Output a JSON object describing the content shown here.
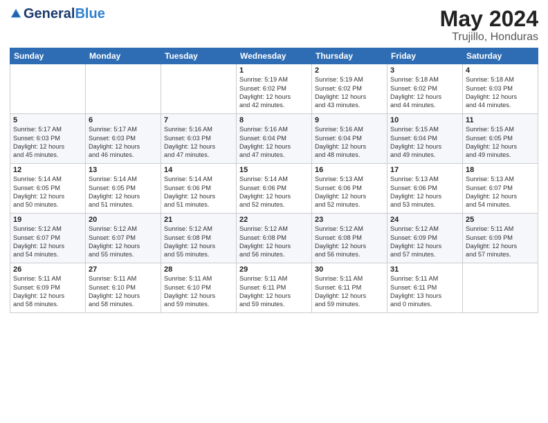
{
  "logo": {
    "general": "General",
    "blue": "Blue"
  },
  "title": {
    "month": "May 2024",
    "location": "Trujillo, Honduras"
  },
  "weekdays": [
    "Sunday",
    "Monday",
    "Tuesday",
    "Wednesday",
    "Thursday",
    "Friday",
    "Saturday"
  ],
  "weeks": [
    [
      {
        "day": null,
        "info": null
      },
      {
        "day": null,
        "info": null
      },
      {
        "day": null,
        "info": null
      },
      {
        "day": "1",
        "info": "Sunrise: 5:19 AM\nSunset: 6:02 PM\nDaylight: 12 hours\nand 42 minutes."
      },
      {
        "day": "2",
        "info": "Sunrise: 5:19 AM\nSunset: 6:02 PM\nDaylight: 12 hours\nand 43 minutes."
      },
      {
        "day": "3",
        "info": "Sunrise: 5:18 AM\nSunset: 6:02 PM\nDaylight: 12 hours\nand 44 minutes."
      },
      {
        "day": "4",
        "info": "Sunrise: 5:18 AM\nSunset: 6:03 PM\nDaylight: 12 hours\nand 44 minutes."
      }
    ],
    [
      {
        "day": "5",
        "info": "Sunrise: 5:17 AM\nSunset: 6:03 PM\nDaylight: 12 hours\nand 45 minutes."
      },
      {
        "day": "6",
        "info": "Sunrise: 5:17 AM\nSunset: 6:03 PM\nDaylight: 12 hours\nand 46 minutes."
      },
      {
        "day": "7",
        "info": "Sunrise: 5:16 AM\nSunset: 6:03 PM\nDaylight: 12 hours\nand 47 minutes."
      },
      {
        "day": "8",
        "info": "Sunrise: 5:16 AM\nSunset: 6:04 PM\nDaylight: 12 hours\nand 47 minutes."
      },
      {
        "day": "9",
        "info": "Sunrise: 5:16 AM\nSunset: 6:04 PM\nDaylight: 12 hours\nand 48 minutes."
      },
      {
        "day": "10",
        "info": "Sunrise: 5:15 AM\nSunset: 6:04 PM\nDaylight: 12 hours\nand 49 minutes."
      },
      {
        "day": "11",
        "info": "Sunrise: 5:15 AM\nSunset: 6:05 PM\nDaylight: 12 hours\nand 49 minutes."
      }
    ],
    [
      {
        "day": "12",
        "info": "Sunrise: 5:14 AM\nSunset: 6:05 PM\nDaylight: 12 hours\nand 50 minutes."
      },
      {
        "day": "13",
        "info": "Sunrise: 5:14 AM\nSunset: 6:05 PM\nDaylight: 12 hours\nand 51 minutes."
      },
      {
        "day": "14",
        "info": "Sunrise: 5:14 AM\nSunset: 6:06 PM\nDaylight: 12 hours\nand 51 minutes."
      },
      {
        "day": "15",
        "info": "Sunrise: 5:14 AM\nSunset: 6:06 PM\nDaylight: 12 hours\nand 52 minutes."
      },
      {
        "day": "16",
        "info": "Sunrise: 5:13 AM\nSunset: 6:06 PM\nDaylight: 12 hours\nand 52 minutes."
      },
      {
        "day": "17",
        "info": "Sunrise: 5:13 AM\nSunset: 6:06 PM\nDaylight: 12 hours\nand 53 minutes."
      },
      {
        "day": "18",
        "info": "Sunrise: 5:13 AM\nSunset: 6:07 PM\nDaylight: 12 hours\nand 54 minutes."
      }
    ],
    [
      {
        "day": "19",
        "info": "Sunrise: 5:12 AM\nSunset: 6:07 PM\nDaylight: 12 hours\nand 54 minutes."
      },
      {
        "day": "20",
        "info": "Sunrise: 5:12 AM\nSunset: 6:07 PM\nDaylight: 12 hours\nand 55 minutes."
      },
      {
        "day": "21",
        "info": "Sunrise: 5:12 AM\nSunset: 6:08 PM\nDaylight: 12 hours\nand 55 minutes."
      },
      {
        "day": "22",
        "info": "Sunrise: 5:12 AM\nSunset: 6:08 PM\nDaylight: 12 hours\nand 56 minutes."
      },
      {
        "day": "23",
        "info": "Sunrise: 5:12 AM\nSunset: 6:08 PM\nDaylight: 12 hours\nand 56 minutes."
      },
      {
        "day": "24",
        "info": "Sunrise: 5:12 AM\nSunset: 6:09 PM\nDaylight: 12 hours\nand 57 minutes."
      },
      {
        "day": "25",
        "info": "Sunrise: 5:11 AM\nSunset: 6:09 PM\nDaylight: 12 hours\nand 57 minutes."
      }
    ],
    [
      {
        "day": "26",
        "info": "Sunrise: 5:11 AM\nSunset: 6:09 PM\nDaylight: 12 hours\nand 58 minutes."
      },
      {
        "day": "27",
        "info": "Sunrise: 5:11 AM\nSunset: 6:10 PM\nDaylight: 12 hours\nand 58 minutes."
      },
      {
        "day": "28",
        "info": "Sunrise: 5:11 AM\nSunset: 6:10 PM\nDaylight: 12 hours\nand 59 minutes."
      },
      {
        "day": "29",
        "info": "Sunrise: 5:11 AM\nSunset: 6:11 PM\nDaylight: 12 hours\nand 59 minutes."
      },
      {
        "day": "30",
        "info": "Sunrise: 5:11 AM\nSunset: 6:11 PM\nDaylight: 12 hours\nand 59 minutes."
      },
      {
        "day": "31",
        "info": "Sunrise: 5:11 AM\nSunset: 6:11 PM\nDaylight: 13 hours\nand 0 minutes."
      },
      {
        "day": null,
        "info": null
      }
    ]
  ]
}
